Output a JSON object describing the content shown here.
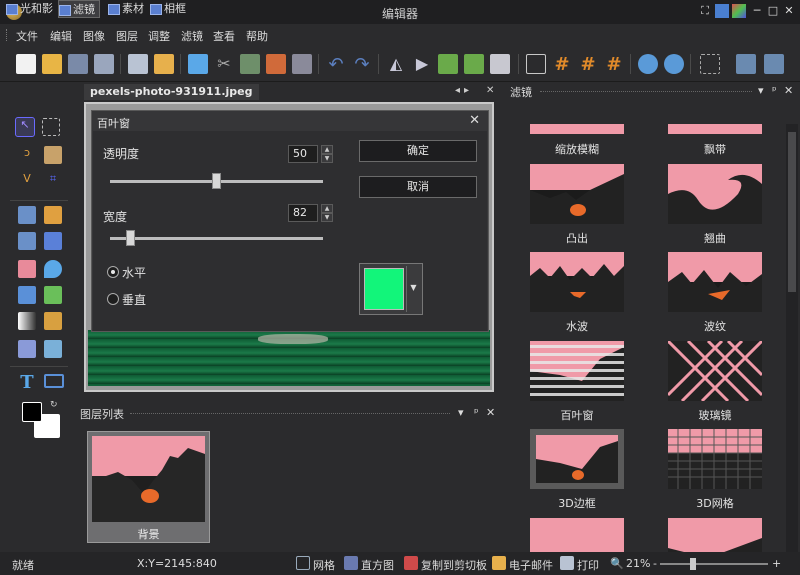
{
  "window": {
    "title": "编辑器"
  },
  "menu": [
    "文件",
    "编辑",
    "图像",
    "图层",
    "调整",
    "滤镜",
    "查看",
    "帮助"
  ],
  "document": {
    "tab_name": "pexels-photo-931911.jpeg"
  },
  "dialog": {
    "title": "百叶窗",
    "opacity_label": "透明度",
    "opacity_value": "50",
    "opacity_fraction": 0.5,
    "width_label": "宽度",
    "width_value": "82",
    "width_fraction": 0.08,
    "ok_label": "确定",
    "cancel_label": "取消",
    "orientation_horizontal": "水平",
    "orientation_vertical": "垂直",
    "orientation_selected": "水平",
    "color": "#12f57a"
  },
  "layers_panel": {
    "title": "图层列表",
    "layers": [
      {
        "name": "背景"
      }
    ]
  },
  "filters_panel": {
    "title": "滤镜",
    "tabs": [
      "光和影",
      "滤镜",
      "素材",
      "相框"
    ],
    "active_tab": "滤镜",
    "items": [
      "缩放模糊",
      "飘带",
      "凸出",
      "翘曲",
      "水波",
      "波纹",
      "百叶窗",
      "玻璃镜",
      "3D边框",
      "3D网格"
    ]
  },
  "status": {
    "state": "就绪",
    "coords": "X:Y=2145:840",
    "grid": "网格",
    "histogram": "直方图",
    "copy_clipboard": "复制到剪切板",
    "email": "电子邮件",
    "print": "打印",
    "zoom": "21%",
    "zoom_minus": "-",
    "zoom_plus": "+"
  },
  "colors": {
    "accent_pink": "#f09aa8",
    "foreground": "#000000",
    "background": "#ffffff"
  }
}
